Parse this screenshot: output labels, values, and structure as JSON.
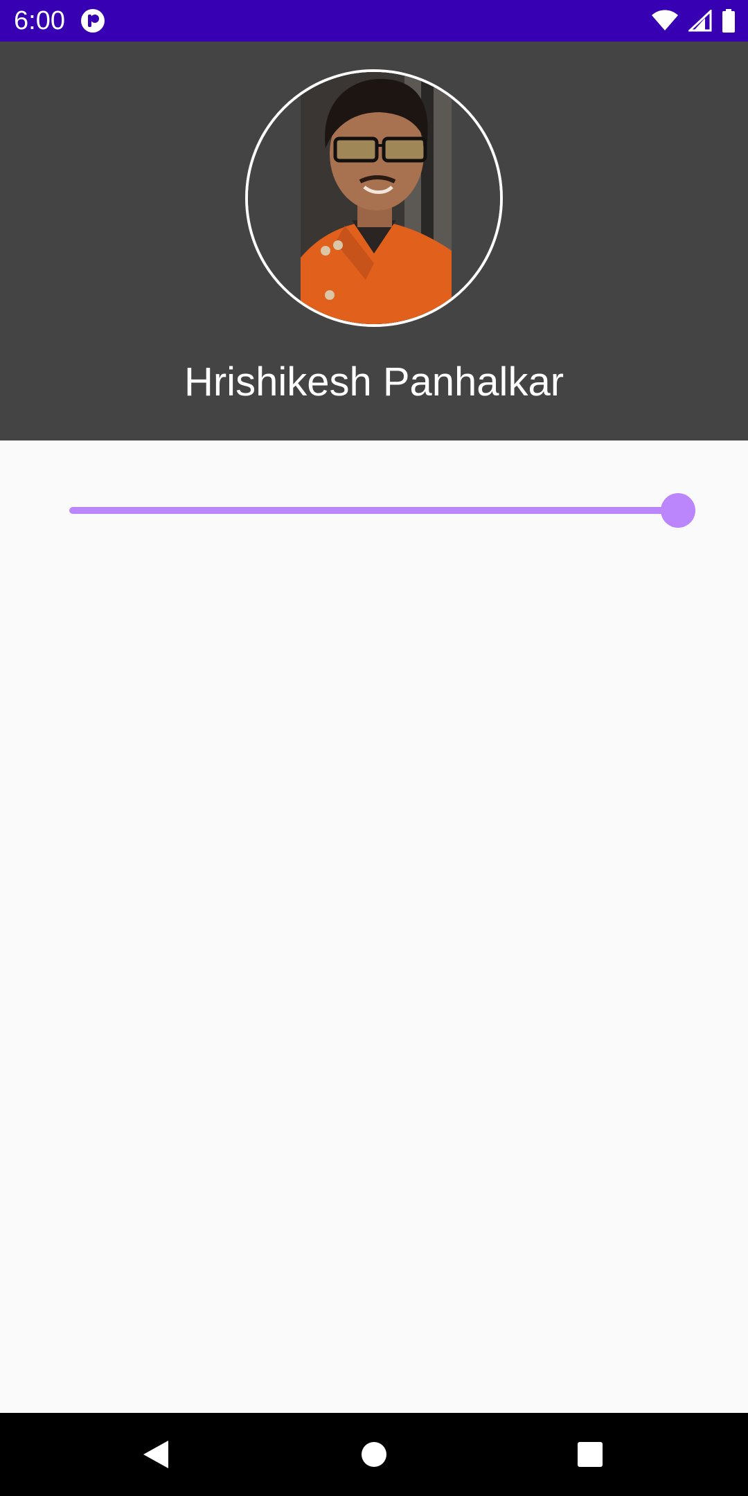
{
  "status_bar": {
    "time": "6:00",
    "background": "#3700b3",
    "icons": [
      "app-notification-icon",
      "wifi-icon",
      "signal-icon",
      "battery-icon"
    ]
  },
  "profile": {
    "name": "Hrishikesh Panhalkar",
    "header_background": "#444444",
    "avatar_icon": "profile-photo"
  },
  "slider": {
    "value": 1.0,
    "accent": "#bb86fc"
  },
  "nav_bar": {
    "icons": [
      "back-icon",
      "home-icon",
      "recents-icon"
    ]
  }
}
